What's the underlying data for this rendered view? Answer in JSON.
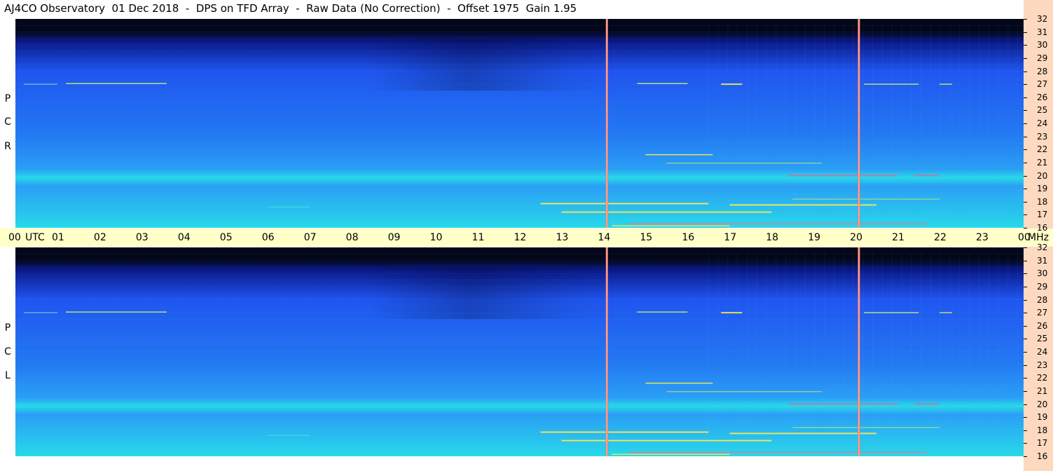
{
  "header": {
    "title": "AJ4CO Observatory  01 Dec 2018  -  DPS on TFD Array  -  Raw Data (No Correction)  -  Offset 1975  Gain 1.95"
  },
  "panels": [
    {
      "id": "rcp",
      "label_letters": [
        "P",
        "C",
        "R"
      ]
    },
    {
      "id": "lcp",
      "label_letters": [
        "P",
        "C",
        "L"
      ]
    }
  ],
  "time_axis": {
    "labels": [
      "00",
      "UTC",
      "01",
      "02",
      "03",
      "04",
      "05",
      "06",
      "07",
      "08",
      "09",
      "10",
      "11",
      "12",
      "13",
      "14",
      "15",
      "16",
      "17",
      "18",
      "19",
      "20",
      "21",
      "22",
      "23",
      "00",
      "MHz"
    ]
  },
  "chart_data": {
    "type": "heatmap",
    "x": {
      "unit": "UTC hour",
      "range": [
        0,
        24
      ],
      "tick_labels": [
        "00",
        "01",
        "02",
        "03",
        "04",
        "05",
        "06",
        "07",
        "08",
        "09",
        "10",
        "11",
        "12",
        "13",
        "14",
        "15",
        "16",
        "17",
        "18",
        "19",
        "20",
        "21",
        "22",
        "23",
        "00"
      ]
    },
    "y": {
      "unit": "MHz",
      "range": [
        16,
        32
      ],
      "tick_labels": [
        "32",
        "31",
        "30",
        "29",
        "28",
        "27",
        "26",
        "25",
        "24",
        "23",
        "22",
        "21",
        "20",
        "19",
        "18",
        "17",
        "16"
      ]
    },
    "channels": [
      "RCP",
      "LCP"
    ],
    "colors": {
      "background_dark": "#03071a",
      "band_low": "#1f55f0",
      "band_mid": "#2a9ff5",
      "band_high": "#27d9e9",
      "hot": "#ffe94b",
      "marker": "#ff6b6b"
    },
    "vertical_markers_hours": [
      14.08,
      20.08
    ]
  }
}
